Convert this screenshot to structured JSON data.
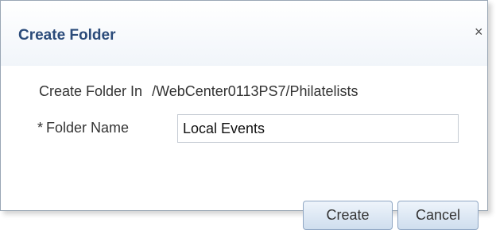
{
  "dialog": {
    "title": "Create Folder",
    "close_glyph": "×",
    "create_in_label": "Create Folder In",
    "create_in_path": "/WebCenter0113PS7/Philatelists",
    "required_mark": "*",
    "folder_name_label": "Folder Name",
    "folder_name_value": "Local Events",
    "create_button": "Create",
    "cancel_button": "Cancel"
  },
  "colors": {
    "title": "#2b4b7a",
    "button_border": "#8fa6c3"
  },
  "icons": {
    "close": "close-icon"
  }
}
